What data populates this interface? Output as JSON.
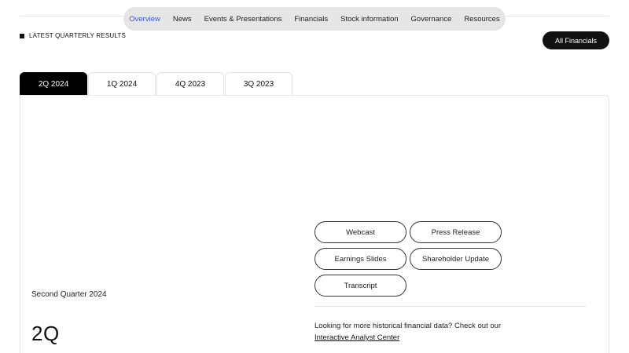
{
  "subnav": {
    "items": [
      "Overview",
      "News",
      "Events & Presentations",
      "Financials",
      "Stock information",
      "Governance",
      "Resources"
    ],
    "active": "Overview",
    "active_color": "#3b5bdb"
  },
  "section": {
    "label": "LATEST QUARTERLY RESULTS"
  },
  "all_financials_label": "All Financials",
  "tabs": [
    {
      "label": "2Q 2024",
      "active": true
    },
    {
      "label": "1Q 2024",
      "active": false
    },
    {
      "label": "4Q 2023",
      "active": false
    },
    {
      "label": "3Q 2023",
      "active": false
    }
  ],
  "quarter": {
    "title": "Second Quarter 2024",
    "short": "2Q"
  },
  "buttons": {
    "webcast": "Webcast",
    "press_release": "Press Release",
    "earnings_slides": "Earnings Slides",
    "shareholder_update": "Shareholder Update",
    "transcript": "Transcript"
  },
  "more": {
    "text": "Looking for more historical financial data? Check out our",
    "link": "Interactive Analyst Center"
  }
}
